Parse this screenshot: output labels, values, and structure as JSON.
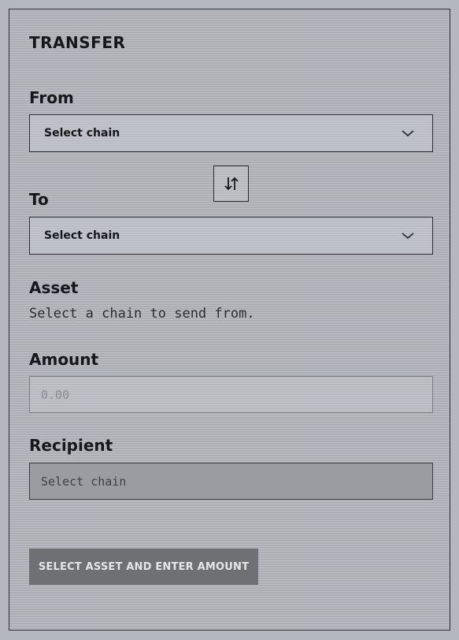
{
  "panel": {
    "title": "TRANSFER"
  },
  "from": {
    "label": "From",
    "select_value": "Select chain",
    "icon": "chevron-down-icon"
  },
  "swap": {
    "icon": "swap-arrows-icon"
  },
  "to": {
    "label": "To",
    "select_value": "Select chain",
    "icon": "chevron-down-icon"
  },
  "asset": {
    "label": "Asset",
    "helper": "Select a chain to send from."
  },
  "amount": {
    "label": "Amount",
    "placeholder": "0.00"
  },
  "recipient": {
    "label": "Recipient",
    "placeholder": "Select chain"
  },
  "action": {
    "button_label": "SELECT ASSET AND ENTER AMOUNT"
  }
}
